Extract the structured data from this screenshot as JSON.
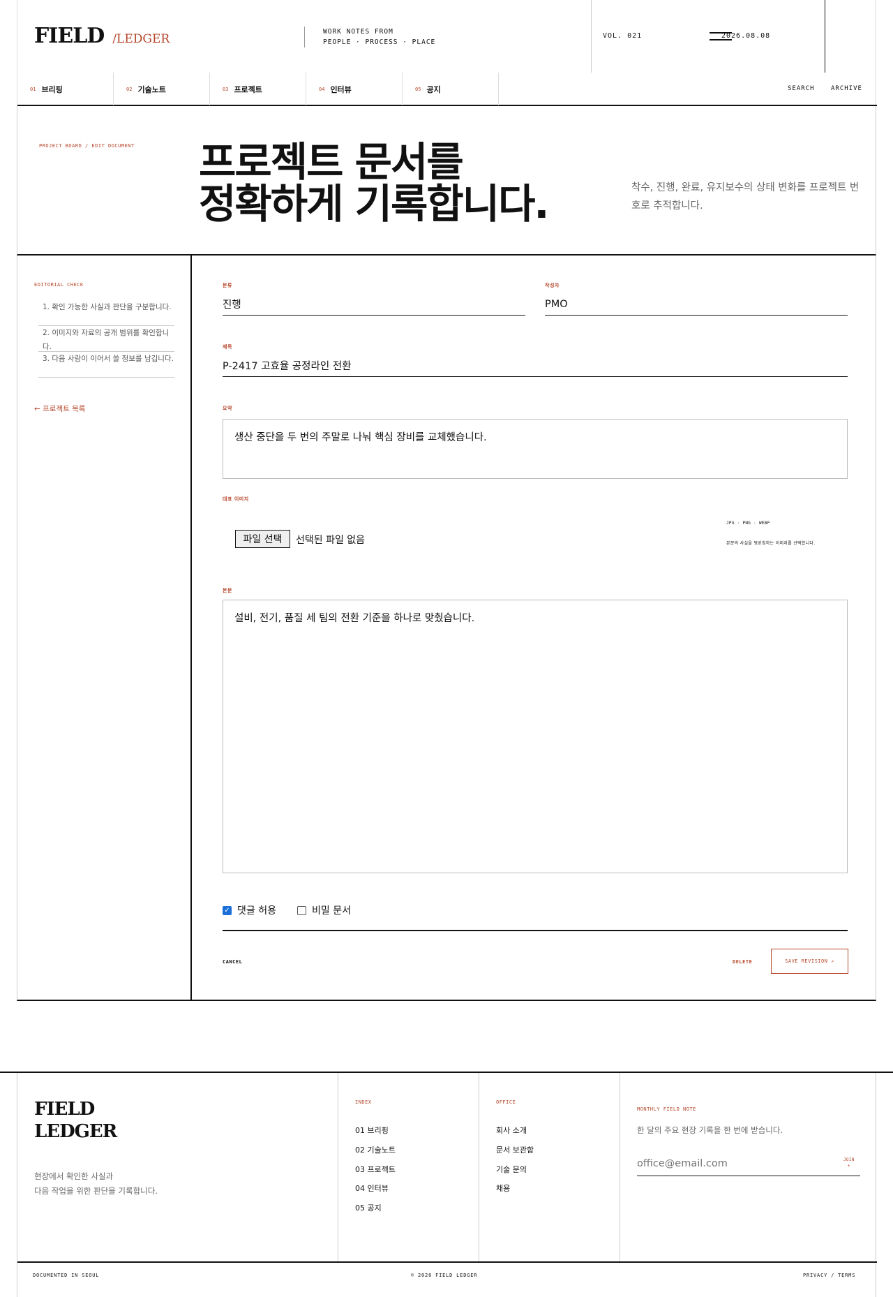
{
  "header": {
    "brand_name": "FIELD",
    "brand_sub": "/LEDGER",
    "tagline_line1": "WORK NOTES FROM",
    "tagline_line2": "PEOPLE · PROCESS · PLACE",
    "volume": "VOL. 021",
    "date": "2026.08.08"
  },
  "nav": {
    "items": [
      {
        "num": "01",
        "label": "브리핑"
      },
      {
        "num": "02",
        "label": "기술노트"
      },
      {
        "num": "03",
        "label": "프로젝트"
      },
      {
        "num": "04",
        "label": "인터뷰"
      },
      {
        "num": "05",
        "label": "공지"
      }
    ],
    "search": "SEARCH",
    "archive": "ARCHIVE"
  },
  "hero": {
    "breadcrumb": "PROJECT BOARD / EDIT DOCUMENT",
    "title_line1": "프로젝트 문서를",
    "title_line2": "정확하게 기록합니다.",
    "description": "착수, 진행, 완료, 유지보수의 상태 변화를 프로젝트 번호로 추적합니다."
  },
  "sidebar": {
    "title": "EDITORIAL CHECK",
    "checks": [
      "1. 확인 가능한 사실과 판단을 구분합니다.",
      "2. 이미지와 자료의 공개 범위를 확인합니다.",
      "3. 다음 사람이 이어서 쓸 정보를 남깁니다."
    ],
    "back_link": "← 프로젝트 목록"
  },
  "form": {
    "category_label": "분류",
    "category_value": "진행",
    "author_label": "작성자",
    "author_value": "PMO",
    "title_label": "제목",
    "title_value": "P-2417 고효율 공정라인 전환",
    "summary_label": "요약",
    "summary_value": "생산 중단을 두 번의 주말로 나눠 핵심 장비를 교체했습니다.",
    "image_label": "대표 이미지",
    "file_button": "파일 선택",
    "file_status": "선택된 파일 없음",
    "image_formats": "JPG · PNG · WEBP",
    "image_hint": "본문의 사실을 뒷받침하는 이미지를 선택합니다.",
    "body_label": "본문",
    "body_value": "설비, 전기, 품질 세 팀의 전환 기준을 하나로 맞췄습니다.",
    "allow_comments_label": "댓글 허용",
    "allow_comments_checked": true,
    "secret_label": "비밀 문서",
    "secret_checked": false,
    "cancel": "CANCEL",
    "delete": "DELETE",
    "save": "SAVE REVISION ↗"
  },
  "footer": {
    "brand_line1": "FIELD",
    "brand_line2": "LEDGER",
    "desc_line1": "현장에서 확인한 사실과",
    "desc_line2": "다음 작업을 위한 판단을 기록합니다.",
    "index_title": "INDEX",
    "index_items": [
      "01 브리핑",
      "02 기술노트",
      "03 프로젝트",
      "04 인터뷰",
      "05 공지"
    ],
    "office_title": "OFFICE",
    "office_items": [
      "회사 소개",
      "문서 보관함",
      "기술 문의",
      "채용"
    ],
    "newsletter_title": "MONTHLY FIELD NOTE",
    "newsletter_desc": "한 달의 주요 현장 기록을 한 번에 받습니다.",
    "email_placeholder": "office@email.com",
    "join_label": "JOIN",
    "join_arrow": "+",
    "bottom_left": "DOCUMENTED IN SEOUL",
    "bottom_center": "© 2026 FIELD LEDGER",
    "bottom_right": "PRIVACY / TERMS"
  },
  "colors": {
    "accent": "#b5462a",
    "ink": "#111111",
    "check": "#1a6fd8"
  }
}
